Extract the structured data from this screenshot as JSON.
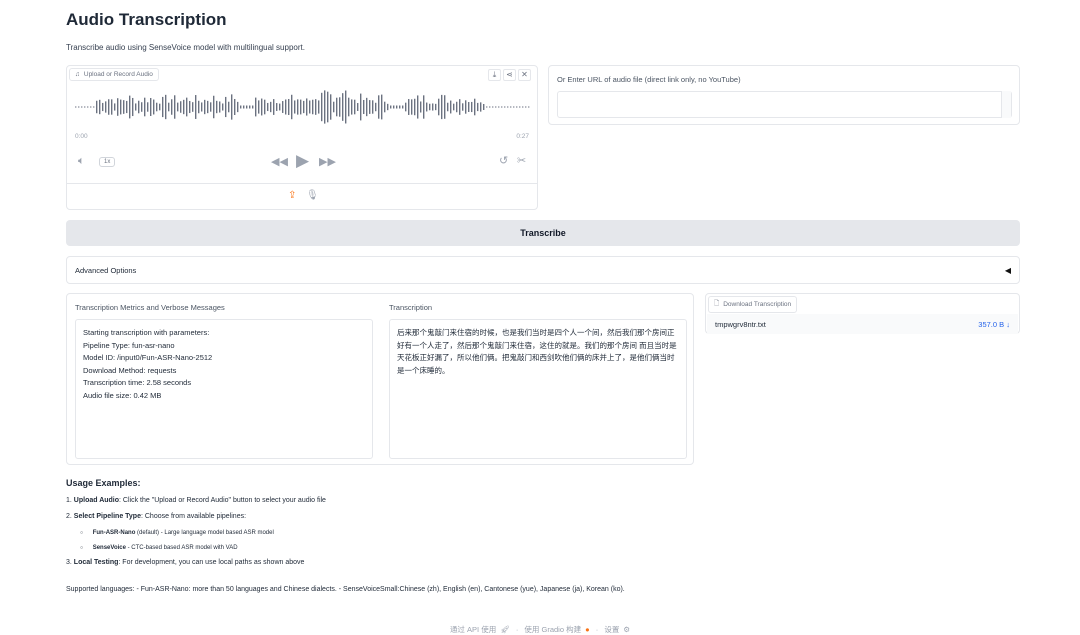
{
  "page": {
    "title": "Audio Transcription",
    "subtitle": "Transcribe audio using SenseVoice model with multilingual support."
  },
  "audio": {
    "label": "Upload or Record Audio",
    "time_start": "0:00",
    "time_end": "0:27",
    "speed": "1x"
  },
  "url": {
    "label": "Or Enter URL of audio file (direct link only, no YouTube)",
    "value": ""
  },
  "transcribe_label": "Transcribe",
  "advanced_label": "Advanced Options",
  "metrics": {
    "label": "Transcription Metrics and Verbose Messages",
    "lines": [
      "Starting transcription with parameters:",
      "Pipeline Type: fun-asr-nano",
      "Model ID: /input0/Fun-ASR-Nano-2512",
      "Download Method: requests",
      "Transcription time: 2.58 seconds",
      "Audio file size: 0.42 MB"
    ]
  },
  "transcription": {
    "label": "Transcription",
    "text": "后来那个鬼敲门来住宿的时候，也是我们当时是四个人一个间，然后我们那个房间正好有一个人走了，然后那个鬼敲门来住宿，这住的就是。我们的那个房间 而且当时是天花板正好漏了，所以他们俩。把鬼敲门和西剑吹他们俩的床并上了，是他们俩当时是一个床睡的。"
  },
  "download": {
    "label": "Download Transcription",
    "file_name": "tmpwgrv8ntr.txt",
    "file_size": "357.0 B ↓"
  },
  "usage": {
    "heading": "Usage Examples:",
    "item1_num": "1.",
    "item1_bold": "Upload Audio",
    "item1_text": ": Click the \"Upload or Record Audio\" button to select your audio file",
    "item2_num": "2.",
    "item2_bold": "Select Pipeline Type",
    "item2_text": ": Choose from available pipelines:",
    "sub1_bold": "Fun-ASR-Nano",
    "sub1_text": " (default) - Large language model based ASR model",
    "sub2_bold": "SenseVoice",
    "sub2_text": " - CTC-based based ASR model with VAD",
    "item3_num": "3.",
    "item3_bold": "Local Testing",
    "item3_text": ": For development, you can use local paths as shown above"
  },
  "supported": "Supported languages: - Fun-ASR-Nano: more than 50 languages and Chinese dialects. - SenseVoiceSmall:Chinese (zh), English (en), Cantonese (yue), Japanese (ja), Korean (ko).",
  "footer": {
    "api": "通过 API 使用",
    "built": "使用 Gradio 构建",
    "settings": "设置",
    "sep": "·"
  },
  "colors": {
    "accent": "#f97316",
    "link": "#2563eb"
  }
}
